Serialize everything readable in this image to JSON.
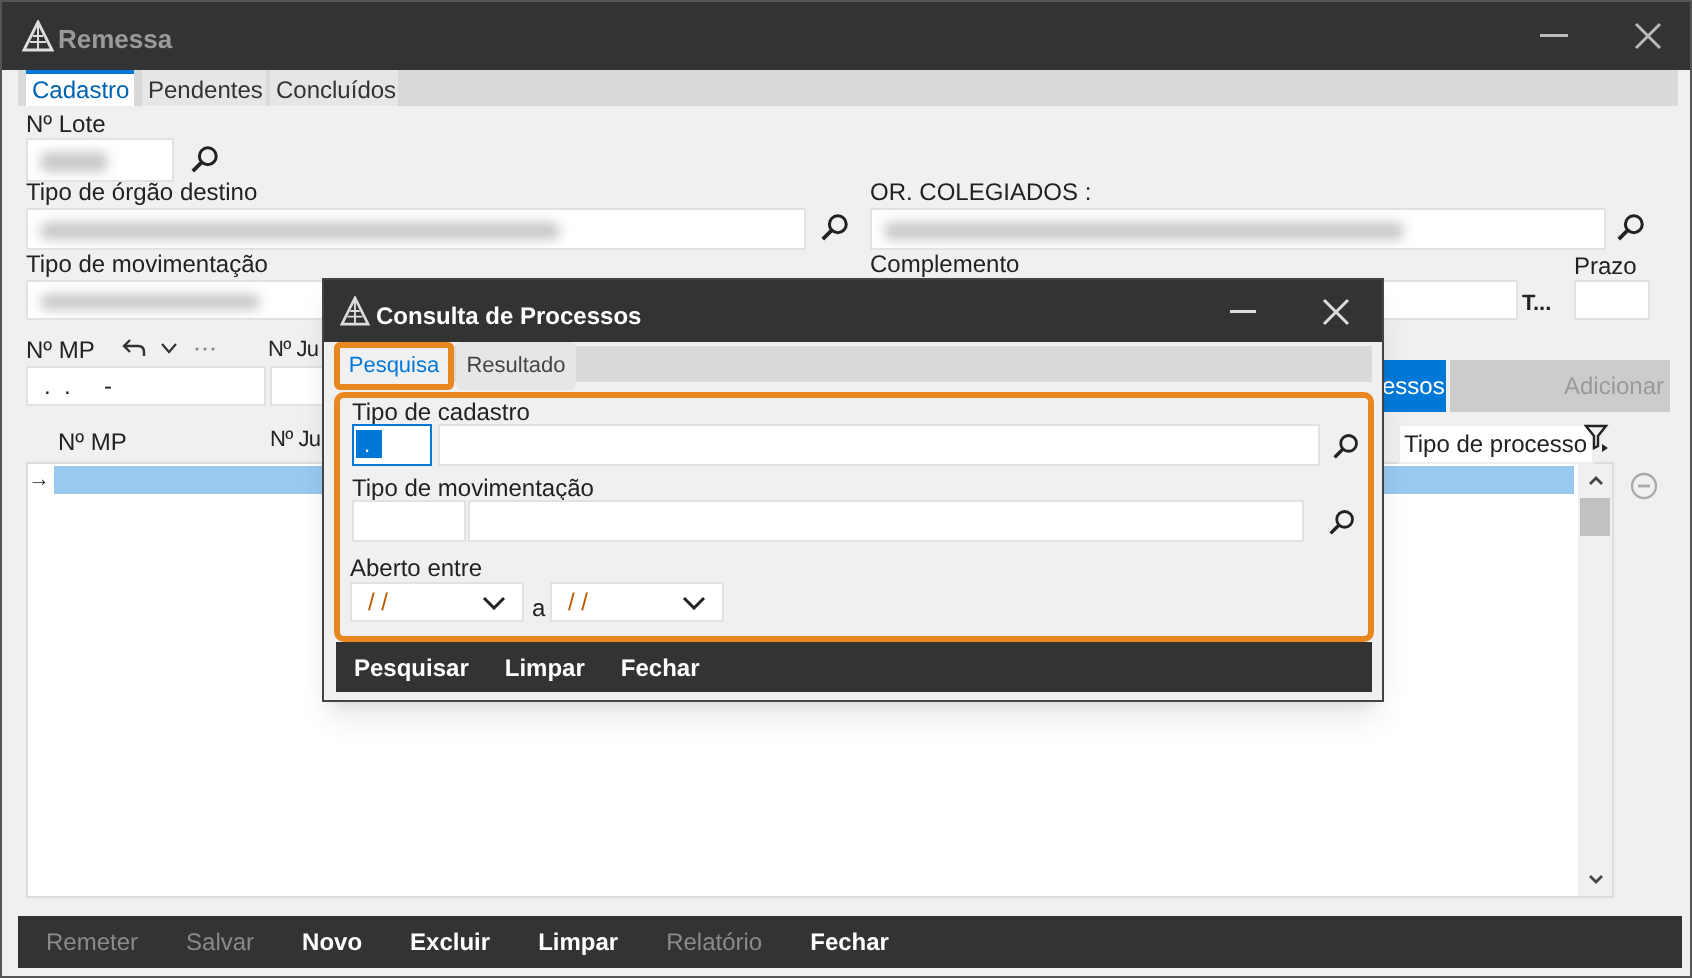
{
  "window": {
    "title": "Remessa"
  },
  "tabs": [
    {
      "label": "Cadastro",
      "selected": true
    },
    {
      "label": "Pendentes",
      "selected": false
    },
    {
      "label": "Concluídos",
      "selected": false
    }
  ],
  "form": {
    "lote": {
      "label": "Nº Lote",
      "redacted": true
    },
    "orgao": {
      "label": "Tipo de órgão destino",
      "redacted": true
    },
    "colegiados": {
      "label": "OR. COLEGIADOS :",
      "redacted": true
    },
    "movimentacao": {
      "label": "Tipo de movimentação",
      "redacted": true
    },
    "complemento": {
      "label": "Complemento"
    },
    "t_label": "T...",
    "prazo": {
      "label": "Prazo"
    },
    "mp": {
      "label": "Nº MP",
      "value": ".  .     -"
    },
    "ju": {
      "label": "Nº Ju"
    }
  },
  "actions": [
    {
      "label": "essos",
      "disabled": false
    },
    {
      "label": "Adicionar",
      "disabled": true
    }
  ],
  "table": {
    "columns": [
      "Nº MP",
      "Nº Ju",
      "Tipo de processo"
    ],
    "rows": [
      {
        "selected": true,
        "marker": "→"
      }
    ]
  },
  "footer_buttons": [
    {
      "label": "Remeter",
      "disabled": true
    },
    {
      "label": "Salvar",
      "disabled": true
    },
    {
      "label": "Novo",
      "disabled": false
    },
    {
      "label": "Excluir",
      "disabled": false
    },
    {
      "label": "Limpar",
      "disabled": false
    },
    {
      "label": "Relatório",
      "disabled": true
    },
    {
      "label": "Fechar",
      "disabled": false
    }
  ],
  "dialog": {
    "title": "Consulta de Processos",
    "tabs": [
      {
        "label": "Pesquisa",
        "selected": true,
        "highlighted": true
      },
      {
        "label": "Resultado",
        "selected": false,
        "highlighted": false
      }
    ],
    "panel_highlighted": true,
    "cadastro": {
      "label": "Tipo de cadastro",
      "code": "."
    },
    "movimentacao": {
      "label": "Tipo de movimentação"
    },
    "aberto": {
      "label": "Aberto entre",
      "from": "/ /",
      "separator": "a",
      "to": "/ /"
    },
    "buttons": [
      "Pesquisar",
      "Limpar",
      "Fechar"
    ]
  }
}
